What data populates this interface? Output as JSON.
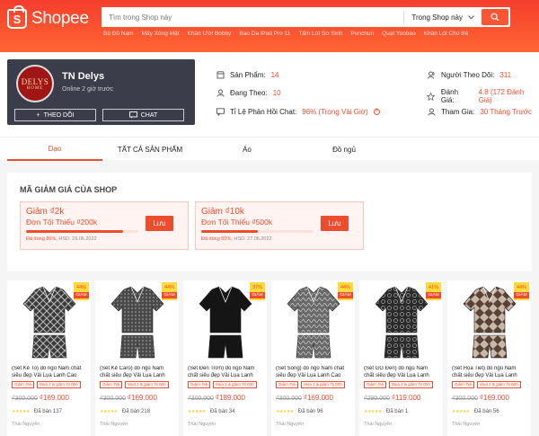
{
  "header": {
    "brand": "Shopee",
    "search_placeholder": "Tìm trong Shop này",
    "search_scope": "Trong Shop này",
    "quick_links": [
      "Bộ Đồ Nam",
      "Máy Xông Mặt",
      "Khăn Ướt Bobby",
      "Bao Da iPad Pro 11",
      "Tẩm Lót Sơ Sinh",
      "Punchun",
      "Quạt Yoobao",
      "Khăn Lót Cho Bé"
    ],
    "colors": {
      "primary": "#ee4d2d",
      "header_gradient_top": "#f53d2d",
      "header_gradient_bottom": "#ff6633"
    }
  },
  "shop": {
    "avatar_text": "DELYS",
    "avatar_subtext": "HOME",
    "name": "TN Delys",
    "online": "Online 2 giờ trước",
    "follow_label": "THEO DÕI",
    "chat_label": "CHAT",
    "stats": {
      "products": {
        "label": "Sản Phẩm:",
        "value": "14"
      },
      "following": {
        "label": "Đang Theo:",
        "value": "10"
      },
      "response": {
        "label": "Tỉ Lệ Phản Hồi Chat:",
        "value": "96% (Trong Vài Giờ)"
      },
      "followers": {
        "label": "Người Theo Dõi:",
        "value": "311"
      },
      "rating": {
        "label": "Đánh Giá:",
        "value": "4.8 (172 Đánh Giá)"
      },
      "joined": {
        "label": "Tham Gia:",
        "value": "30 Tháng Trước"
      }
    }
  },
  "tabs": [
    {
      "label": "Dạo",
      "active": true
    },
    {
      "label": "TẤT CẢ SẢN PHẨM",
      "active": false
    },
    {
      "label": "Áo",
      "active": false
    },
    {
      "label": "Đồ ngủ",
      "active": false
    }
  ],
  "vouchers": {
    "title": "MÃ GIẢM GIÁ CỦA SHOP",
    "items": [
      {
        "name": "Giảm ₫2k",
        "min": "Đơn Tối Thiểu ₫200k",
        "used": "Đã dùng 86%,",
        "expiry": "HSD: 23.06.2022",
        "progress": 0.86,
        "save_label": "Lưu"
      },
      {
        "name": "Giảm ₫10k",
        "min": "Đơn Tối Thiểu ₫500k",
        "used": "Đã dùng 50%,",
        "expiry": "HSD: 27.06.2022",
        "progress": 0.5,
        "save_label": "Lưu"
      }
    ]
  },
  "products": [
    {
      "title": "(Set Kẻ To) đồ ngủ Nam chất siêu đẹp Vải Lụa Lanh Cao Cấ...",
      "tags": [
        "Giảm ₫5k",
        "Mua 2 & giảm ₫5.000"
      ],
      "old": "₫300.000",
      "price": "₫169.000",
      "sold": "Đã bán 137",
      "location": "Thái Nguyên",
      "discount": "44%",
      "off": "GIẢM",
      "shirt": "#3a3a3a",
      "pattern": "plaid"
    },
    {
      "title": "(Set Kẻ Caro) đồ ngủ Nam chất siêu đẹp Vải Lụa Lanh Cao Cấ...",
      "tags": [
        "Giảm ₫5k",
        "Mua 2 & giảm ₫5.000"
      ],
      "old": "₫300.000",
      "price": "₫169.000",
      "sold": "Đã bán 218",
      "location": "Thái Nguyên",
      "discount": "44%",
      "off": "GIẢM",
      "shirt": "#4a4a4a",
      "pattern": "check"
    },
    {
      "title": "(Set Đen Trơn) đồ ngủ Nam chất siêu đẹp Vải Lụa Lanh Cao Cấp (Hà...",
      "tags": [
        "Giảm ₫5k",
        "Mua 2 & giảm ₫5.000"
      ],
      "old": "₫300.000",
      "price": "₫189.000",
      "sold": "Đã bán 34",
      "location": "Thái Nguyên",
      "discount": "37%",
      "off": "GIẢM",
      "shirt": "#151515",
      "pattern": "plain"
    },
    {
      "title": "(Set Sóng) đồ ngủ Nam chất siêu đẹp Vải Lụa Lanh Cao Cấ...",
      "tags": [
        "Giảm ₫5k",
        "Mua 2 & giảm ₫5.000"
      ],
      "old": "₫300.000",
      "price": "₫169.000",
      "sold": "Đã bán 96",
      "location": "Thái Nguyên",
      "discount": "44%",
      "off": "GIẢM",
      "shirt": "#6a6a6a",
      "pattern": "wave"
    },
    {
      "title": "(Set GG Đen) đồ ngủ Nam chất siêu đẹp Vải Lụa Lanh Cao Cấ...",
      "tags": [
        "Giảm ₫5k",
        "Mua 2 & giảm ₫5.000"
      ],
      "old": "₫290.000",
      "price": "₫119.000",
      "sold": "Đã bán 1",
      "location": "Thái Nguyên",
      "discount": "41%",
      "off": "GIẢM",
      "shirt": "#2a2a2a",
      "pattern": "gg"
    },
    {
      "title": "(Set Họa Tiết) đồ ngủ Nam chất siêu đẹp Vải Lụa Lanh Cao Cấ...",
      "tags": [
        "Giảm ₫5k",
        "Mua 2 & giảm ₫5.000"
      ],
      "old": "₫300.000",
      "price": "₫169.000",
      "sold": "Đã bán 56",
      "location": "Thái Nguyên",
      "discount": "44%",
      "off": "GIẢM",
      "shirt": "#5a4238",
      "pattern": "print"
    }
  ]
}
